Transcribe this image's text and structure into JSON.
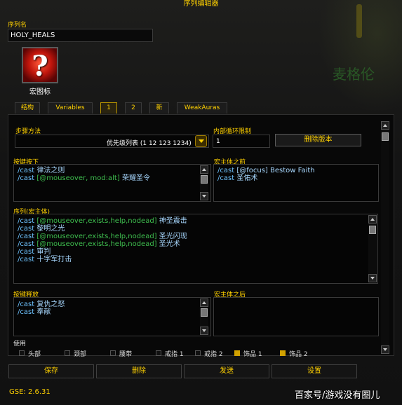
{
  "window": {
    "title": "序列编辑器"
  },
  "sequence": {
    "name_label": "序列名",
    "name_value": "HOLY_HEALS",
    "macro_icon_label": "宏图标"
  },
  "tabs": [
    {
      "label": "结构"
    },
    {
      "label": "Variables"
    },
    {
      "label": "1"
    },
    {
      "label": "2"
    },
    {
      "label": "新"
    },
    {
      "label": "WeakAuras"
    }
  ],
  "step": {
    "label": "步骤方法",
    "value": "优先级列表 (1 12 123 1234)",
    "loop_label": "内部循环限制",
    "loop_value": "1",
    "delete_button": "删除版本"
  },
  "keypress": {
    "label": "按键按下",
    "lines": [
      {
        "cmd": "/cast",
        "cond": "",
        "spell": "律法之则"
      },
      {
        "cmd": "/cast",
        "cond": "[@mouseover, mod:alt]",
        "spell": "荣耀圣令"
      }
    ]
  },
  "premacro": {
    "label": "宏主体之前",
    "lines": [
      {
        "cmd": "/cast",
        "cond": "[@focus]",
        "spell": "Bestow Faith"
      },
      {
        "cmd": "/cast",
        "cond": "",
        "spell": "圣佑术"
      }
    ]
  },
  "sequence_body": {
    "label": "序列(宏主体)",
    "lines": [
      {
        "cmd": "/cast",
        "cond": "[@mouseover,exists,help,nodead]",
        "spell": "神圣震击"
      },
      {
        "cmd": "/cast",
        "cond": "",
        "spell": "黎明之光"
      },
      {
        "cmd": "/cast",
        "cond": "[@mouseover,exists,help,nodead]",
        "spell": "圣光闪现"
      },
      {
        "cmd": "/cast",
        "cond": "[@mouseover,exists,help,nodead]",
        "spell": "圣光术"
      },
      {
        "cmd": "/cast",
        "cond": "",
        "spell": "审判"
      },
      {
        "cmd": "/cast",
        "cond": "",
        "spell": "十字军打击"
      }
    ]
  },
  "keyrelease": {
    "label": "按键释放",
    "lines": [
      {
        "cmd": "/cast",
        "cond": "",
        "spell": "复仇之怒"
      },
      {
        "cmd": "/cast",
        "cond": "",
        "spell": "奉献"
      }
    ]
  },
  "postmacro": {
    "label": "宏主体之后"
  },
  "use": {
    "label": "使用",
    "items": [
      {
        "label": "头部",
        "checked": false
      },
      {
        "label": "颈部",
        "checked": false
      },
      {
        "label": "腰带",
        "checked": false
      },
      {
        "label": "戒指 1",
        "checked": false
      },
      {
        "label": "戒指 2",
        "checked": false
      },
      {
        "label": "饰品 1",
        "checked": true
      },
      {
        "label": "饰品 2",
        "checked": true
      }
    ]
  },
  "bottom": {
    "save": "保存",
    "delete": "删除",
    "send": "发送",
    "settings": "设置"
  },
  "footer": {
    "version": "GSE: 2.6.31",
    "watermark": "百家号/游戏没有圈儿"
  },
  "colors": {
    "gold": "#ffd100",
    "keyword": "#6ec3ff",
    "condition": "#3fbf4f"
  }
}
